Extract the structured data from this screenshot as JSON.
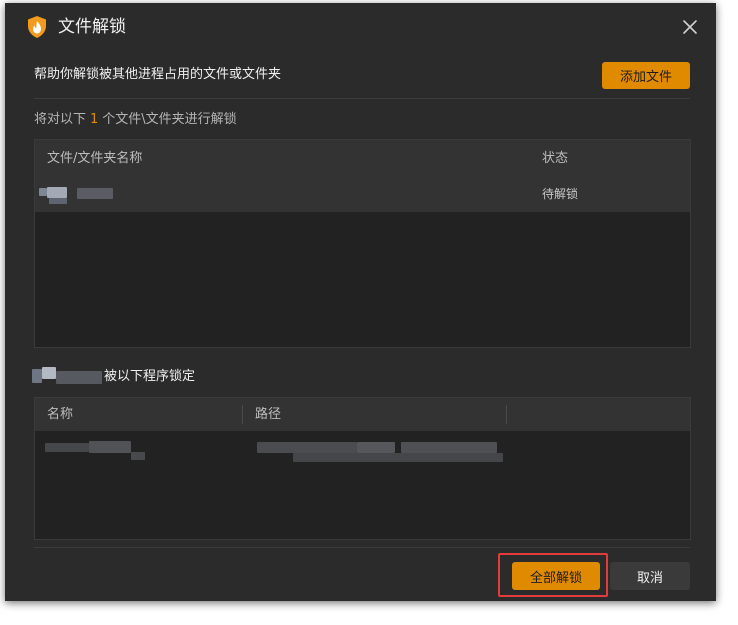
{
  "window": {
    "title": "文件解锁",
    "close_icon": "close-icon",
    "app_icon": "shield-flame-icon",
    "accent": "#e08a00",
    "background": "#2b2b2b"
  },
  "header": {
    "description": "帮助你解锁被其他进程占用的文件或文件夹",
    "add_file_label": "添加文件"
  },
  "summary": {
    "prefix": "将对以下",
    "count": "1",
    "suffix": "个文件\\文件夹进行解锁"
  },
  "files_table": {
    "columns": [
      "文件/文件夹名称",
      "状态"
    ],
    "rows": [
      {
        "name": "",
        "status": "待解锁"
      }
    ]
  },
  "locked_by": {
    "label": "被以下程序锁定"
  },
  "process_table": {
    "columns": [
      "名称",
      "路径",
      ""
    ],
    "rows": [
      {
        "name": "",
        "path": ""
      }
    ]
  },
  "footer": {
    "unlock_all_label": "全部解锁",
    "cancel_label": "取消",
    "highlight_color": "#e23b3b"
  }
}
